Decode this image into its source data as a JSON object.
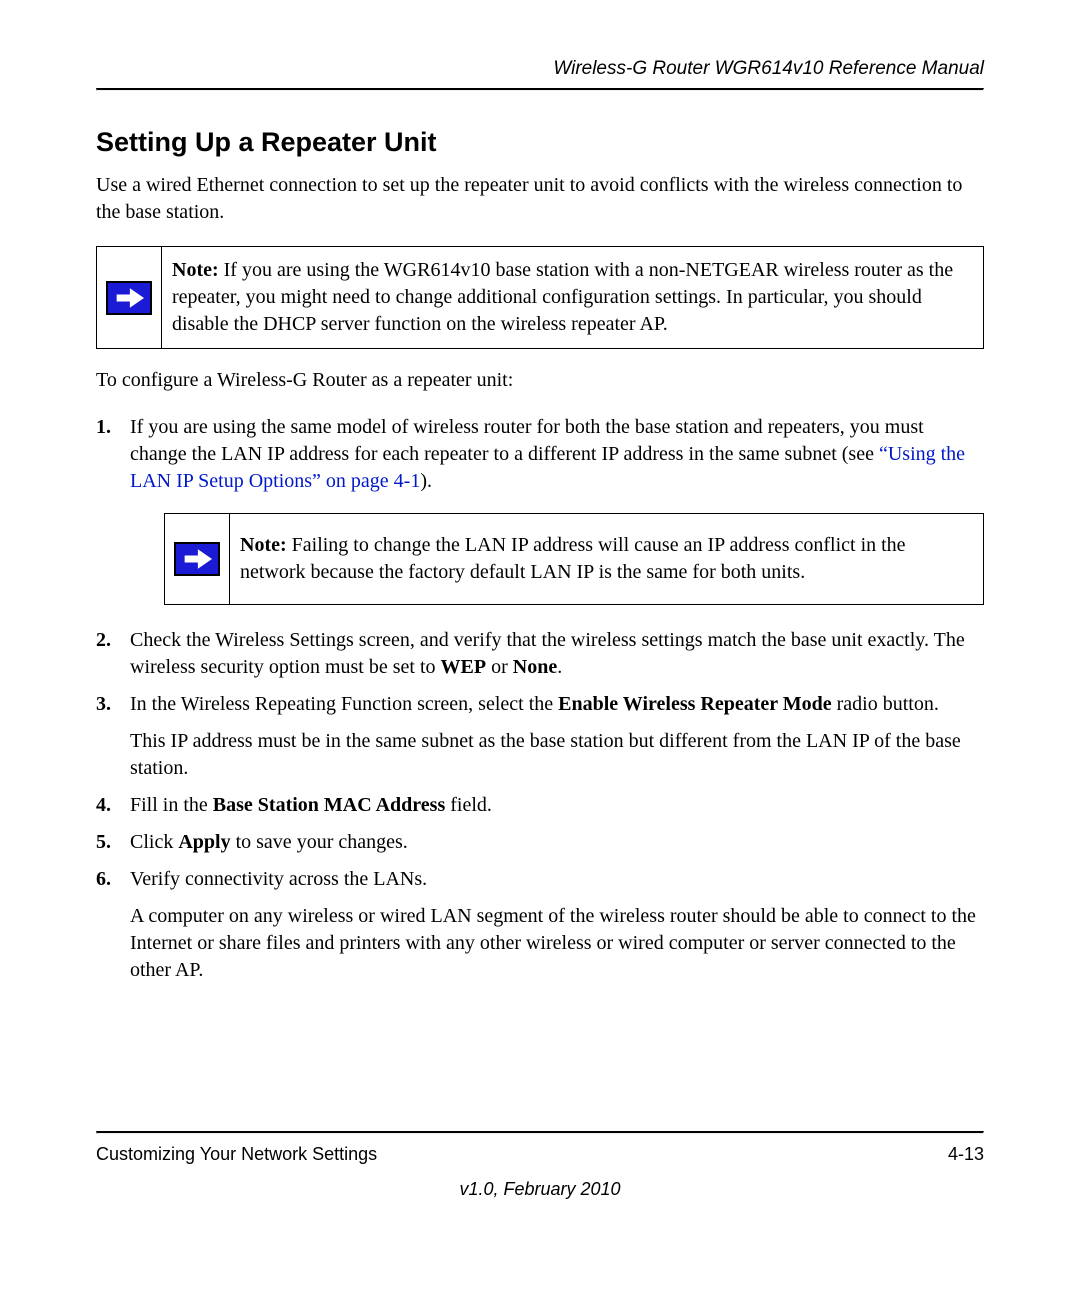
{
  "header": {
    "manual_title": "Wireless-G Router WGR614v10 Reference Manual"
  },
  "section": {
    "title": "Setting Up a Repeater Unit",
    "intro": "Use a wired Ethernet connection to set up the repeater unit to avoid conflicts with the wireless connection to the base station."
  },
  "note1": {
    "label": "Note:",
    "text": " If you are using the WGR614v10 base station with a non-NETGEAR wireless router as the repeater, you might need to change additional configuration settings. In particular, you should disable the DHCP server function on the wireless repeater AP."
  },
  "lead_in": "To configure a Wireless-G Router as a repeater unit:",
  "step1": {
    "pre": "If you are using the same model of wireless router for both the base station and repeaters, you must change the LAN IP address for each repeater to a different IP address in the same subnet (see ",
    "link": "“Using the LAN IP Setup Options” on page 4-1",
    "post": ")."
  },
  "note2": {
    "label": "Note:",
    "text": " Failing to change the LAN IP address will cause an IP address conflict in the network because the factory default LAN IP is the same for both units."
  },
  "step2": {
    "pre": "Check the Wireless Settings screen, and verify that the wireless settings match the base unit exactly. The wireless security option must be set to ",
    "b1": "WEP",
    "mid": " or ",
    "b2": "None",
    "post": "."
  },
  "step3": {
    "pre": "In the Wireless Repeating Function screen, select the ",
    "b1": "Enable Wireless Repeater Mode",
    "post": " radio button.",
    "para2": "This IP address must be in the same subnet as the base station but different from the LAN IP of the base station."
  },
  "step4": {
    "pre": "Fill in the ",
    "b1": "Base Station MAC Address",
    "post": " field."
  },
  "step5": {
    "pre": "Click ",
    "b1": "Apply",
    "post": " to save your changes."
  },
  "step6": {
    "line1": "Verify connectivity across the LANs.",
    "para2": "A computer on any wireless or wired LAN segment of the wireless router should be able to connect to the Internet or share files and printers with any other wireless or wired computer or server connected to the other AP."
  },
  "footer": {
    "section": "Customizing Your Network Settings",
    "page": "4-13",
    "version": "v1.0, February 2010"
  }
}
